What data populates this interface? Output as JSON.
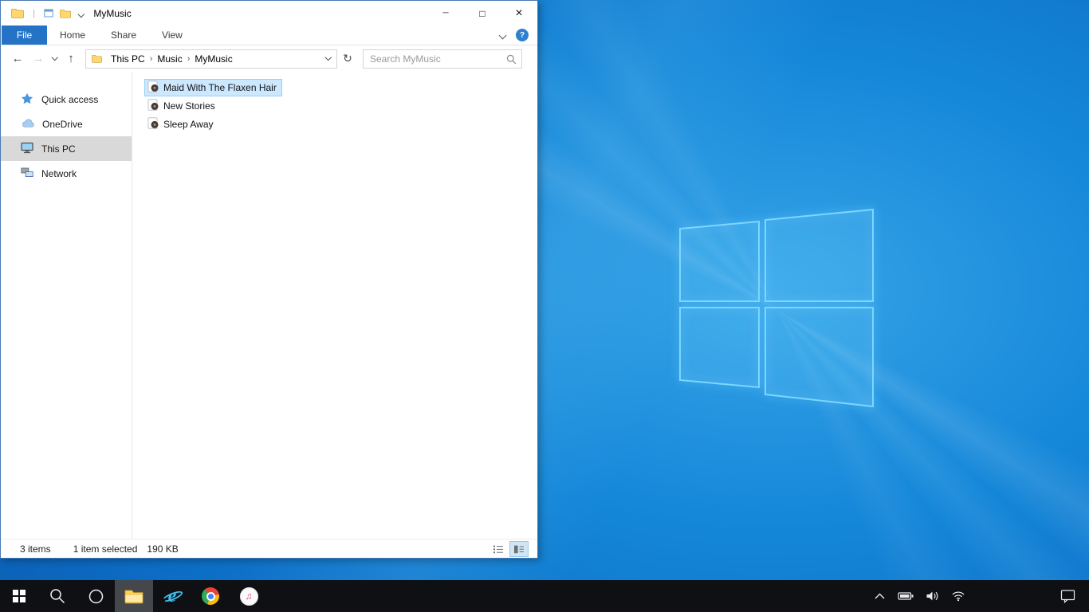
{
  "window": {
    "title": "MyMusic",
    "controls": {
      "minimize": "─",
      "maximize": "□",
      "close": "×"
    },
    "ribbon": {
      "file_tab": "File",
      "tabs": [
        {
          "label": "Home"
        },
        {
          "label": "Share"
        },
        {
          "label": "View"
        }
      ],
      "help_label": "?"
    },
    "addressbar": {
      "back_glyph": "←",
      "forward_glyph": "→",
      "up_glyph": "↑",
      "refresh_glyph": "↻",
      "separator": "›",
      "breadcrumb": [
        {
          "label": "This PC"
        },
        {
          "label": "Music"
        },
        {
          "label": "MyMusic"
        }
      ],
      "search_placeholder": "Search MyMusic"
    },
    "sidebar": {
      "items": [
        {
          "label": "Quick access",
          "icon": "quick-access-star-icon",
          "selected": false
        },
        {
          "label": "OneDrive",
          "icon": "onedrive-cloud-icon",
          "selected": false
        },
        {
          "label": "This PC",
          "icon": "this-pc-monitor-icon",
          "selected": true
        },
        {
          "label": "Network",
          "icon": "network-computers-icon",
          "selected": false
        }
      ]
    },
    "files": {
      "items": [
        {
          "name": "Maid With The Flaxen Hair",
          "icon": "music-file-icon",
          "selected": true
        },
        {
          "name": "New Stories",
          "icon": "music-file-icon",
          "selected": false
        },
        {
          "name": "Sleep Away",
          "icon": "music-file-icon",
          "selected": false
        }
      ]
    },
    "statusbar": {
      "item_count": "3 items",
      "selection": "1 item selected",
      "selection_size": "190 KB"
    }
  },
  "taskbar": {
    "buttons": [
      "start",
      "search",
      "cortana",
      "file-explorer",
      "internet-explorer",
      "chrome",
      "itunes"
    ],
    "active_button": "file-explorer",
    "tray": [
      "show-hidden-icons",
      "battery",
      "volume",
      "network",
      "action-center"
    ],
    "itunes_note_glyph": "♫"
  },
  "colors": {
    "accent": "#0078d7",
    "selection_bg": "#cce8ff",
    "selection_border": "#98d0f4",
    "inactive_selection": "#d9d9d9",
    "file_tab_blue": "#2473c6",
    "taskbar_bg": "#0e1013",
    "desktop_blue": "#0d6ec6",
    "logo_edge": "#7cd6ff"
  }
}
